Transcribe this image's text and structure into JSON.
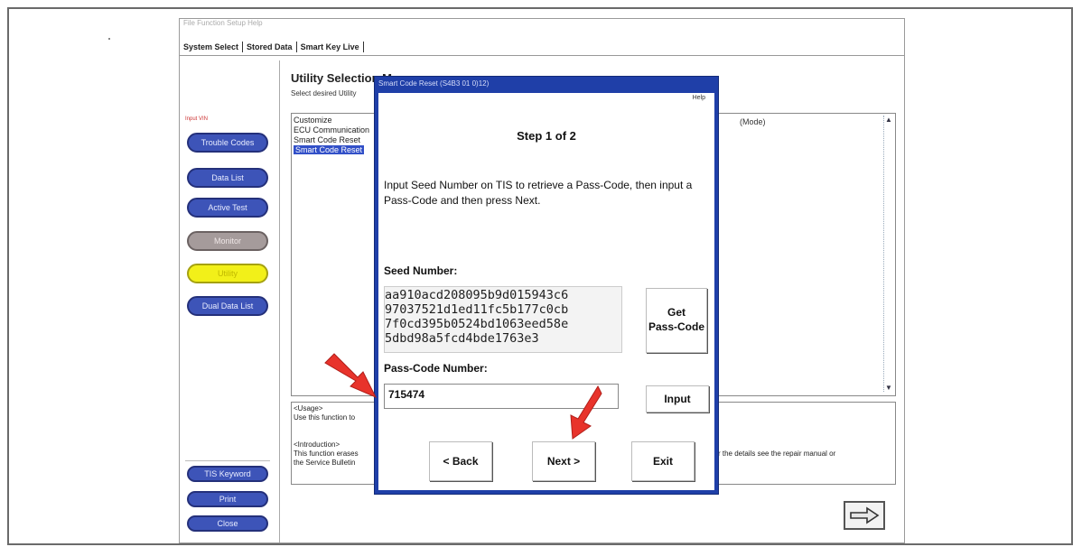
{
  "app": {
    "menubar": "File  Function  Setup  Help",
    "tabs": [
      "System Select",
      "Stored Data",
      "Smart Key Live"
    ]
  },
  "sidebar": {
    "input_vin": "Input VIN",
    "buttons": [
      "Trouble Codes",
      "Data List",
      "Active Test",
      "Monitor",
      "Utility",
      "Dual Data List"
    ],
    "bottom_buttons": [
      "TIS Keyword",
      "Print",
      "Close"
    ]
  },
  "main": {
    "title": "Utility Selection Menu",
    "subtitle": "Select desired Utility",
    "list_items": [
      "Customize",
      "ECU Communication",
      "Smart Code Reset",
      "Smart Code Reset"
    ],
    "list_right": "(Mode)",
    "info_lines": [
      "<Usage>",
      "Use this function to",
      "<Introduction>",
      "This function erases",
      "the Service Bulletin"
    ],
    "info_right": "r the details see the repair manual or"
  },
  "dialog": {
    "title": "Smart Code Reset (S4B3 01 0)12)",
    "help": "Help",
    "step": "Step 1 of 2",
    "instruction": "Input Seed Number on TIS to retrieve a Pass-Code, then input a Pass-Code and then press Next.",
    "seed_label": "Seed Number:",
    "seed_value": "aa910acd208095b9d015943c6\n97037521d1ed11fc5b177c0cb\n7f0cd395b0524bd1063eed58e\n5dbd98a5fcd4bde1763e3",
    "get_passcode": "Get\nPass-Code",
    "passcode_label": "Pass-Code Number:",
    "passcode_value": "715474",
    "input_label": "Input",
    "back_label": "< Back",
    "next_label": "Next >",
    "exit_label": "Exit"
  },
  "colors": {
    "dialog_blue": "#1f3fa8",
    "sidebar_button_blue": "#3d54b8",
    "highlight_yellow": "#f2f019",
    "selection_blue": "#3250c8",
    "arrow_red": "#e8332b"
  }
}
